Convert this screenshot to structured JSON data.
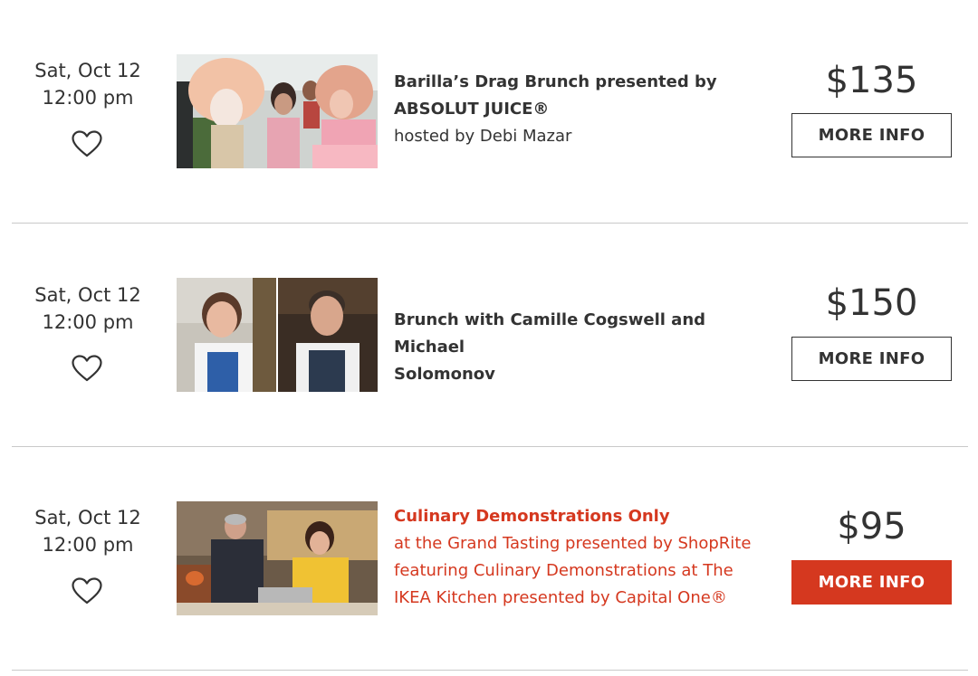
{
  "events": [
    {
      "date": "Sat, Oct 12",
      "time": "12:00 pm",
      "title_lines": [
        "Barilla’s Drag Brunch presented by",
        "ABSOLUT JUICE®"
      ],
      "subtitle_lines": [
        "hosted by Debi Mazar"
      ],
      "price": "$135",
      "button_label": "MORE INFO",
      "highlight": false
    },
    {
      "date": "Sat, Oct 12",
      "time": "12:00 pm",
      "title_lines": [
        "Brunch with Camille Cogswell and Michael",
        "Solomonov"
      ],
      "subtitle_lines": [],
      "price": "$150",
      "button_label": "MORE INFO",
      "highlight": false
    },
    {
      "date": "Sat, Oct 12",
      "time": "12:00 pm",
      "title_lines": [
        "Culinary Demonstrations Only"
      ],
      "subtitle_lines": [
        "at the Grand Tasting presented by ShopRite",
        "featuring Culinary Demonstrations at The",
        "IKEA Kitchen presented by Capital One®"
      ],
      "price": "$95",
      "button_label": "MORE INFO",
      "highlight": true
    }
  ],
  "icons": {
    "favorite": "heart-outline-icon"
  },
  "colors": {
    "accent": "#d5381f",
    "text": "#333333",
    "divider": "#c9c9c9"
  }
}
